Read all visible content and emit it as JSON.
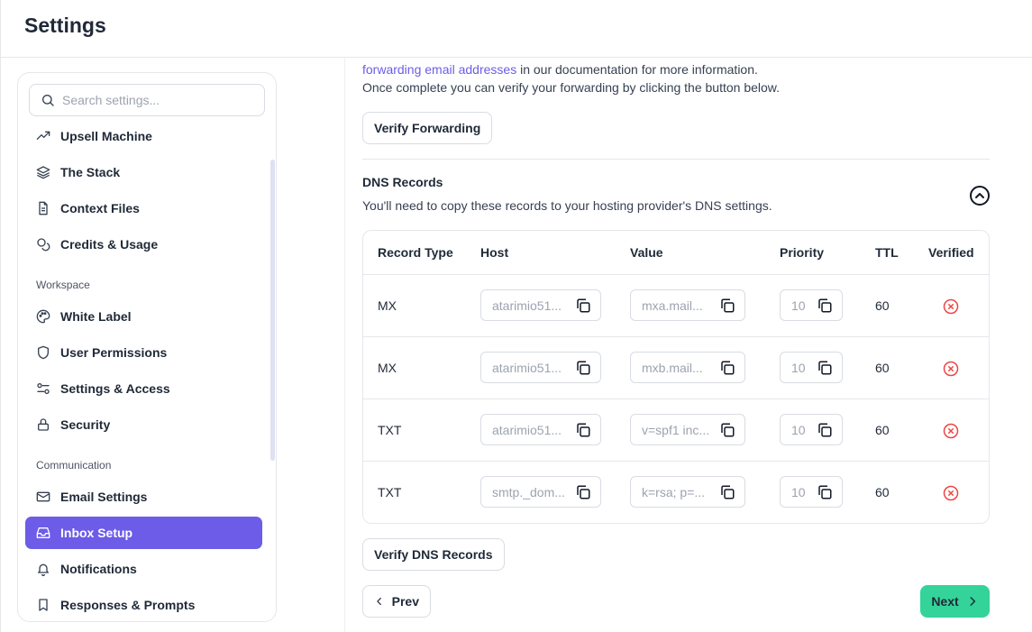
{
  "header": {
    "title": "Settings"
  },
  "search": {
    "placeholder": "Search settings..."
  },
  "sidebar": {
    "group1": [
      {
        "label": "Upsell Machine",
        "icon": "trending-up-icon"
      },
      {
        "label": "The Stack",
        "icon": "layers-icon"
      },
      {
        "label": "Context Files",
        "icon": "file-text-icon"
      },
      {
        "label": "Credits & Usage",
        "icon": "coins-icon"
      }
    ],
    "section_workspace": "Workspace",
    "group2": [
      {
        "label": "White Label",
        "icon": "palette-icon"
      },
      {
        "label": "User Permissions",
        "icon": "shield-icon"
      },
      {
        "label": "Settings & Access",
        "icon": "sliders-icon"
      },
      {
        "label": "Security",
        "icon": "lock-icon"
      }
    ],
    "section_communication": "Communication",
    "group3": [
      {
        "label": "Email Settings",
        "icon": "mail-icon"
      },
      {
        "label": "Inbox Setup",
        "icon": "inbox-icon",
        "active": true
      },
      {
        "label": "Notifications",
        "icon": "bell-icon"
      },
      {
        "label": "Responses & Prompts",
        "icon": "bookmark-icon"
      }
    ]
  },
  "main": {
    "intro_link": "forwarding email addresses",
    "intro_line1_rest": " in our documentation for more information.",
    "intro_line2": "Once complete you can verify your forwarding by clicking the button below.",
    "verify_forwarding_label": "Verify Forwarding",
    "dns_title": "DNS Records",
    "dns_desc": "You'll need to copy these records to your hosting provider's DNS settings.",
    "columns": [
      "Record Type",
      "Host",
      "Value",
      "Priority",
      "TTL",
      "Verified"
    ],
    "rows": [
      {
        "type": "MX",
        "host": "atarimio51...",
        "value": "mxa.mail...",
        "priority": "10",
        "ttl": "60"
      },
      {
        "type": "MX",
        "host": "atarimio51...",
        "value": "mxb.mail...",
        "priority": "10",
        "ttl": "60"
      },
      {
        "type": "TXT",
        "host": "atarimio51...",
        "value": "v=spf1 inc...",
        "priority": "10",
        "ttl": "60"
      },
      {
        "type": "TXT",
        "host": "smtp._dom...",
        "value": "k=rsa; p=...",
        "priority": "10",
        "ttl": "60"
      }
    ],
    "verify_dns_label": "Verify DNS Records",
    "prev_label": "Prev",
    "next_label": "Next"
  },
  "colors": {
    "accent": "#6c5ce7",
    "next": "#34d399",
    "error": "#ef4444"
  }
}
